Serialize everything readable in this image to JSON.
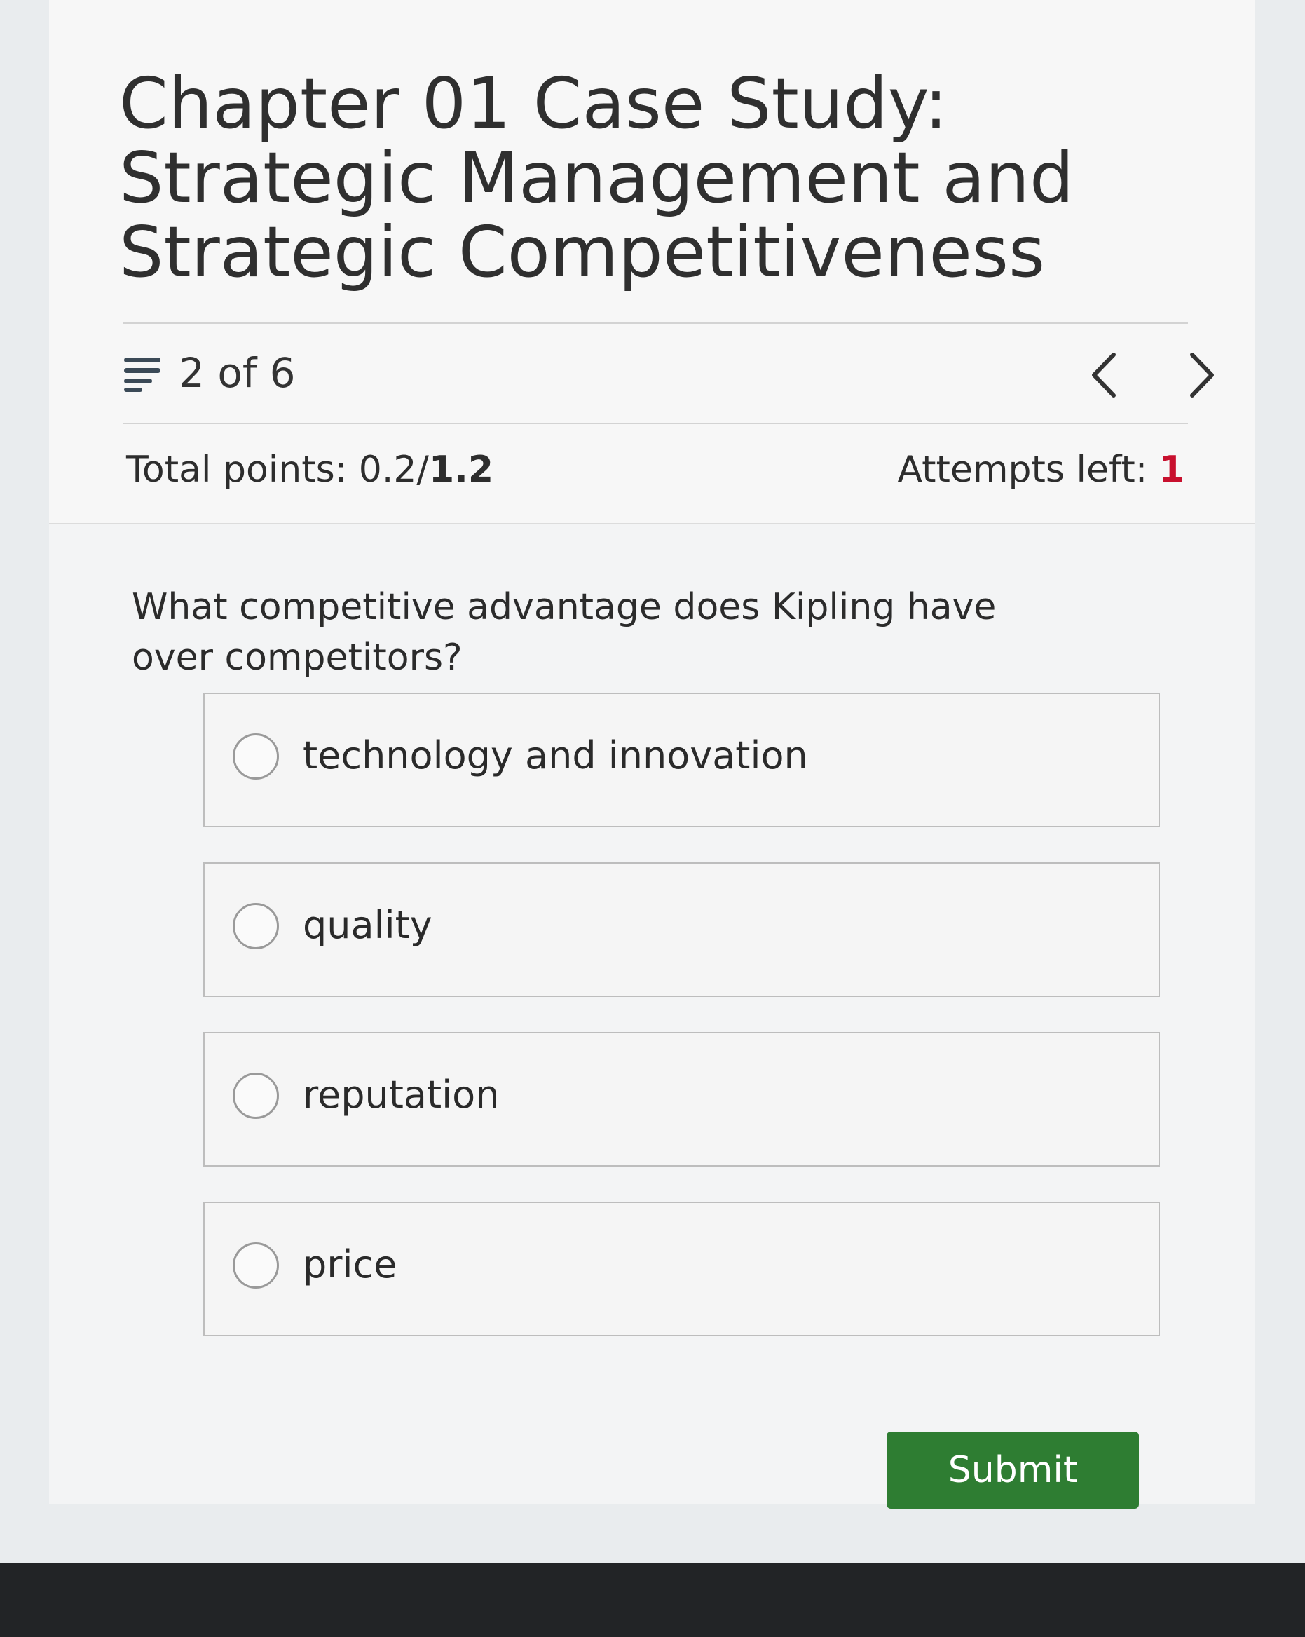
{
  "quiz": {
    "title": "Chapter 01 Case Study: Strategic Management and Strategic Competitiveness",
    "progress": "2 of 6",
    "total_points_label": "Total points: 0.2/",
    "total_points_max": "1.2",
    "attempts_label": "Attempts left: ",
    "attempts_value": "1"
  },
  "question": {
    "text": "What competitive advantage does Kipling have over competitors?",
    "options": [
      "technology and innovation",
      "quality",
      "reputation",
      "price"
    ]
  },
  "actions": {
    "submit_label": "Submit"
  },
  "icons": {
    "list": "list-icon",
    "prev": "chevron-left-icon",
    "next": "chevron-right-icon"
  },
  "colors": {
    "submit": "#2e7d32",
    "attempts": "#c8102e"
  }
}
